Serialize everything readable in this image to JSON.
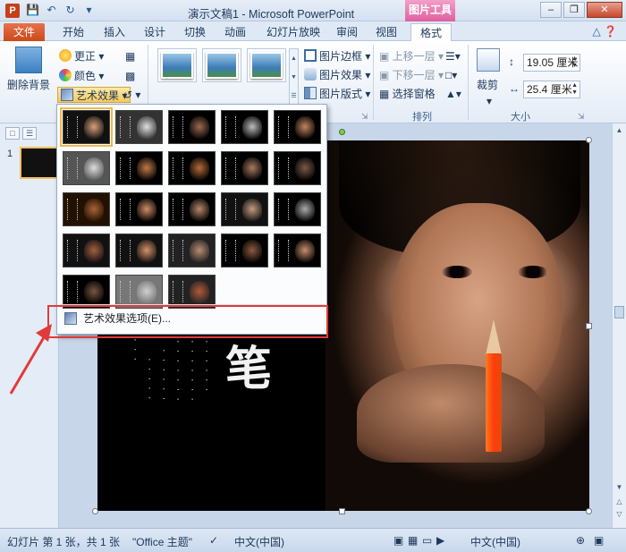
{
  "titlebar": {
    "title": "演示文稿1 - Microsoft PowerPoint",
    "tool_header": "图片工具",
    "app_icon": "P"
  },
  "tabs": [
    {
      "label": "文件"
    },
    {
      "label": "开始"
    },
    {
      "label": "插入"
    },
    {
      "label": "设计"
    },
    {
      "label": "切换"
    },
    {
      "label": "动画"
    },
    {
      "label": "幻灯片放映"
    },
    {
      "label": "审阅"
    },
    {
      "label": "视图"
    },
    {
      "label": "格式"
    }
  ],
  "ribbon": {
    "remove_bg": "删除背景",
    "corrections": "更正",
    "color": "颜色",
    "artistic_effects": "艺术效果",
    "picture_border": "图片边框",
    "picture_effects": "图片效果",
    "picture_layout": "图片版式",
    "bring_forward": "上移一层",
    "send_backward": "下移一层",
    "selection_pane": "选择窗格",
    "crop": "裁剪",
    "arrange_label": "排列",
    "size_label": "大小",
    "height_value": "19.05 厘米",
    "width_value": "25.4 厘米"
  },
  "dropdown": {
    "options_label": "艺术效果选项(E)..."
  },
  "slide": {
    "big_char": "笔"
  },
  "statusbar": {
    "slide_info": "幻灯片 第 1 张，共 1 张",
    "theme": "\"Office 主题\"",
    "language": "中文(中国)",
    "language2": "中文(中国)"
  },
  "slide_pane": {
    "slide_number": "1"
  }
}
